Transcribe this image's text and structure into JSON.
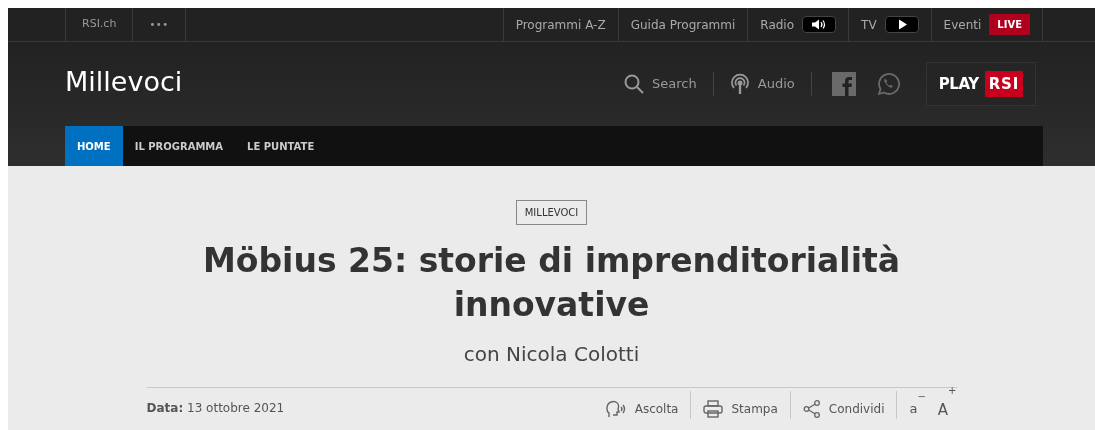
{
  "top_bar": {
    "left_links": [
      {
        "label": "RSI.ch",
        "kind": "site"
      },
      {
        "label": "•••",
        "kind": "more"
      }
    ],
    "right_links": [
      {
        "label": "Programmi A-Z",
        "kind": "plain"
      },
      {
        "label": "Guida Programmi",
        "kind": "plain"
      },
      {
        "label": "Radio",
        "kind": "radio"
      },
      {
        "label": "TV",
        "kind": "tv"
      },
      {
        "label": "Eventi",
        "kind": "live",
        "badge": "LIVE"
      }
    ]
  },
  "header": {
    "title": "Millevoci",
    "search": "Search",
    "audio": "Audio",
    "play_logo": {
      "play": "PLAY",
      "rsi": "RSI"
    }
  },
  "nav": [
    {
      "label": "HOME",
      "selected": true
    },
    {
      "label": "IL PROGRAMMA",
      "selected": false
    },
    {
      "label": "LE PUNTATE",
      "selected": false
    }
  ],
  "article": {
    "tag": "MILLEVOCI",
    "title": "Möbius 25: storie di imprenditorialità innovative",
    "subtitle": "con Nicola Colotti",
    "date": "**Data:** 13 ottobre 2021",
    "actions": [
      {
        "label": "Ascolta",
        "kind": "listen"
      },
      {
        "label": "Stampa",
        "kind": "print"
      },
      {
        "label": "Condividi",
        "kind": "share"
      }
    ],
    "font_controls": [
      {
        "label": "a",
        "sign": "−"
      },
      {
        "label": "A",
        "sign": "+"
      }
    ]
  }
}
